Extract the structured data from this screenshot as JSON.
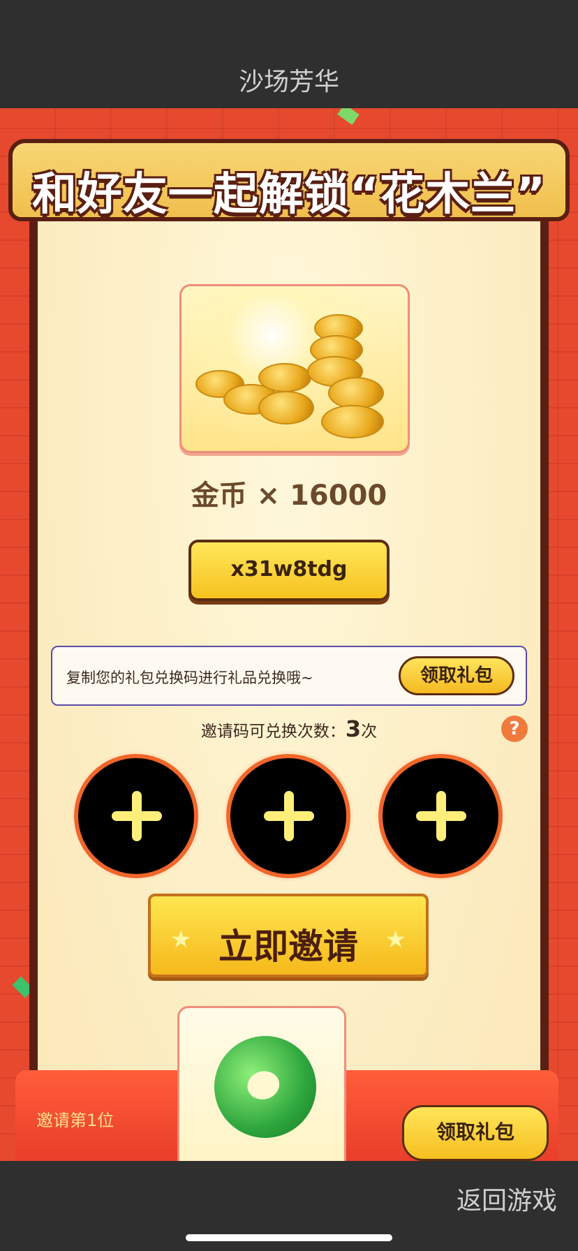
{
  "topbar": {
    "title": "沙场芳华"
  },
  "banner": {
    "title": "和好友一起解锁“花木兰”"
  },
  "reward": {
    "label": "金币 × 16000",
    "icon": "gold-coins-icon"
  },
  "code": {
    "value": "x31w8tdg"
  },
  "hint": {
    "text": "复制您的礼包兑换码进行礼品兑换哦~",
    "claim_label": "领取礼包"
  },
  "invite_count": {
    "prefix": "邀请码可兑换次数：",
    "number": "3",
    "suffix": "次",
    "help_icon": "?"
  },
  "slots": [
    {
      "icon": "plus-icon"
    },
    {
      "icon": "plus-icon"
    },
    {
      "icon": "plus-icon"
    }
  ],
  "invite_button": {
    "label": "立即邀请"
  },
  "bottom": {
    "label": "邀请第1位",
    "claim_label": "领取礼包"
  },
  "bottombar": {
    "back_label": "返回游戏"
  },
  "colors": {
    "background": "#e24a2f",
    "accent": "#f5c020",
    "dark": "#5a1f12",
    "text": "#3a2210"
  }
}
